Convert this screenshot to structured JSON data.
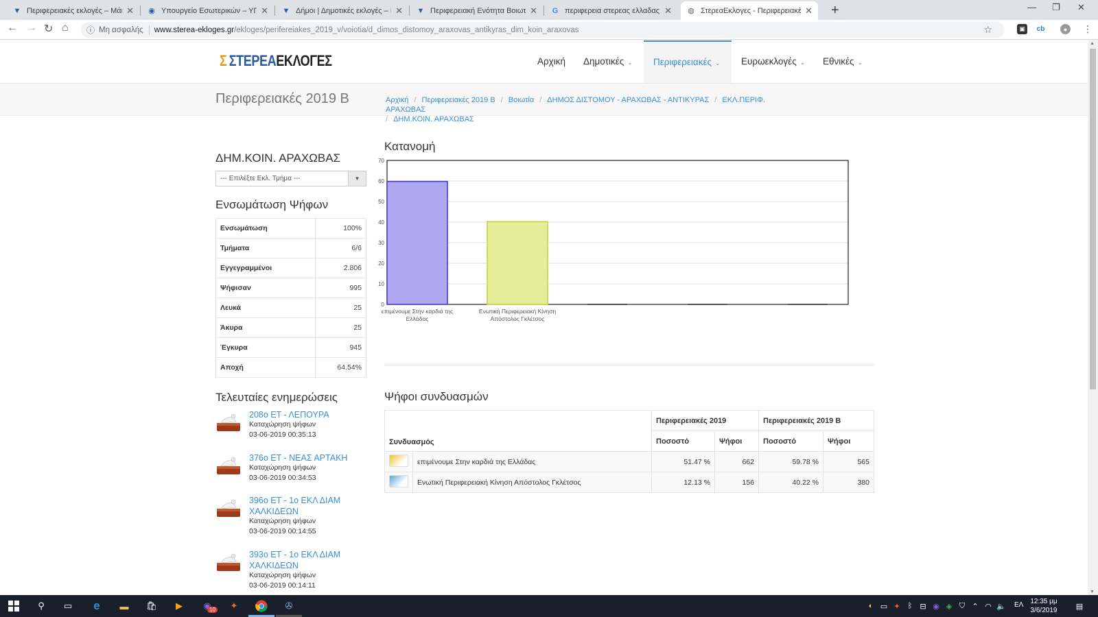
{
  "browser": {
    "tabs": [
      {
        "title": "Περιφερειακές εκλογές – Μάιος"
      },
      {
        "title": "Υπουργείο Εσωτερικών – ΥΠΕΣ"
      },
      {
        "title": "Δήμοι | Δημοτικές εκλογές – Μά"
      },
      {
        "title": "Περιφερειακή Ενότητα Βοιωτία"
      },
      {
        "title": "περιφερεια στερεας ελλαδας εκ"
      },
      {
        "title": "ΣτερεαΕκλογες - Περιφερειακές"
      }
    ],
    "new_tab": "+",
    "security_label": "Μη ασφαλής",
    "url_host": "www.sterea-ekloges.gr",
    "url_path": "/ekloges/perifereiakes_2019_v/voiotia/d_dimos_distomoy_araxovas_antikyras_dim_koin_araxovas"
  },
  "site": {
    "logo_sigma": "Σ",
    "logo_part1": "ΣΤΕΡΕΑ",
    "logo_part2": "ΕΚΛΟΓΕΣ",
    "nav": [
      {
        "label": "Αρχική"
      },
      {
        "label": "Δημοτικές"
      },
      {
        "label": "Περιφερειακές"
      },
      {
        "label": "Ευρωεκλογές"
      },
      {
        "label": "Εθνικές"
      }
    ]
  },
  "page": {
    "title": "Περιφερειακές 2019 Β",
    "breadcrumb": [
      "Αρχική",
      "Περιφερειακές 2019 Β",
      "Βοιωτία",
      "ΔΗΜΟΣ ΔΙΣΤΟΜΟΥ - ΑΡΑΧΩΒΑΣ - ΑΝΤΙΚΥΡΑΣ",
      "ΕΚΛ.ΠΕΡΙΦ. ΑΡΑΧΩΒΑΣ",
      "ΔΗΜ.ΚΟΙΝ. ΑΡΑΧΩΒΑΣ"
    ]
  },
  "left": {
    "dk_title": "ΔΗΜ.ΚΟΙΝ. ΑΡΑΧΩΒΑΣ",
    "select_value": "--- Επιλέξτε Εκλ. Τμήμα ---",
    "ensom_title": "Ενσωμάτωση Ψήφων",
    "stats": [
      {
        "label": "Ενσωμάτωση",
        "value": "100%"
      },
      {
        "label": "Τμήματα",
        "value": "6/6"
      },
      {
        "label": "Εγγεγραμμένοι",
        "value": "2.806"
      },
      {
        "label": "Ψήφισαν",
        "value": "995"
      },
      {
        "label": "Λευκά",
        "value": "25"
      },
      {
        "label": "Άκυρα",
        "value": "25"
      },
      {
        "label": "Έγκυρα",
        "value": "945"
      },
      {
        "label": "Αποχή",
        "value": "64.54%"
      }
    ],
    "updates_title": "Τελευταίες ενημερώσεις",
    "updates": [
      {
        "name": "208ο ΕΤ - ΛΕΠΟΥΡΑ",
        "desc": "Καταχώρηση ψήφων",
        "time": "03-06-2019 00:35:13"
      },
      {
        "name": "376ο ΕΤ - ΝΕΑΣ ΑΡΤΑΚΗ",
        "desc": "Καταχώρηση ψήφων",
        "time": "03-06-2019 00:34:53"
      },
      {
        "name": "396ο ΕΤ - 1ο ΕΚΛ ΔΙΑΜ ΧΑΛΚΙΔΕΩΝ",
        "desc": "Καταχώρηση ψήφων",
        "time": "03-06-2019 00:14:55"
      },
      {
        "name": "393ο ΕΤ - 1ο ΕΚΛ ΔΙΑΜ ΧΑΛΚΙΔΕΩΝ",
        "desc": "Καταχώρηση ψήφων",
        "time": "03-06-2019 00:14:11"
      }
    ]
  },
  "chart_title": "Κατανομή",
  "chart_data": {
    "type": "bar",
    "categories": [
      "επιμένουμε Στην καρδιά της Ελλάδας",
      "Ενωτική Περιφερειακή Κίνηση Απόστολος Γκλέτσος",
      "",
      "",
      ""
    ],
    "values": [
      59.78,
      40.22,
      0,
      0,
      0
    ],
    "colors": [
      "#b0a7f2",
      "#e7ee9b"
    ],
    "border_colors": [
      "#4a38d6",
      "#c6d43a"
    ],
    "ylim": [
      0,
      70
    ],
    "yticks": [
      0,
      10,
      20,
      30,
      40,
      50,
      60,
      70
    ],
    "grid": true
  },
  "votes": {
    "title": "Ψήφοι συνδυασμών",
    "col_party": "Συνδυασμός",
    "group1": "Περιφερειακές 2019",
    "group2": "Περιφερειακές 2019 Β",
    "col_pct": "Ποσοστό",
    "col_votes": "Ψήφοι",
    "rows": [
      {
        "party": "επιμένουμε Στην καρδιά της Ελλάδας",
        "pct1": "51.47 %",
        "votes1": "662",
        "pct2": "59.78 %",
        "votes2": "565",
        "logo_color": "#f2c230"
      },
      {
        "party": "Ενωτική Περιφερειακή Κίνηση Απόστολος Γκλέτσος",
        "pct1": "12.13 %",
        "votes1": "156",
        "pct2": "40.22 %",
        "votes2": "380",
        "logo_color": "#57a9d6"
      }
    ]
  },
  "taskbar": {
    "clock_time": "12:35 μμ",
    "clock_date": "3/6/2019",
    "lang": "ΕΛ",
    "viber_badge": "10"
  }
}
